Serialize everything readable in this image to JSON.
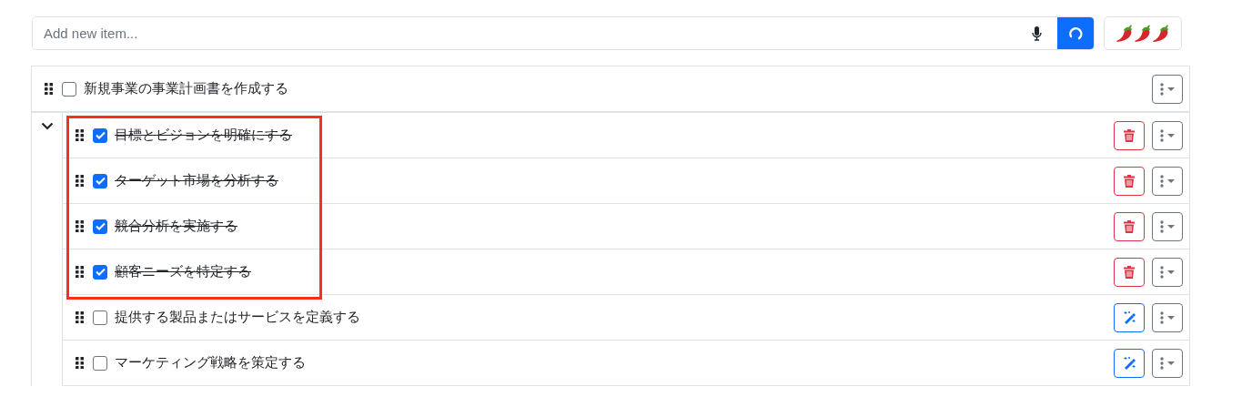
{
  "new_item": {
    "placeholder": "Add new item..."
  },
  "task": {
    "label": "新規事業の事業計画書を作成する",
    "checked": false,
    "expanded": true,
    "children": [
      {
        "label": "目標とビジョンを明確にする",
        "checked": true,
        "kind": "delete",
        "highlighted": true
      },
      {
        "label": "ターゲット市場を分析する",
        "checked": true,
        "kind": "delete",
        "highlighted": true
      },
      {
        "label": "競合分析を実施する",
        "checked": true,
        "kind": "delete",
        "highlighted": true
      },
      {
        "label": "顧客ニーズを特定する",
        "checked": true,
        "kind": "delete",
        "highlighted": true
      },
      {
        "label": "提供する製品またはサービスを定義する",
        "checked": false,
        "kind": "magic",
        "highlighted": false
      },
      {
        "label": "マーケティング戦略を策定する",
        "checked": false,
        "kind": "magic",
        "highlighted": false
      }
    ]
  }
}
